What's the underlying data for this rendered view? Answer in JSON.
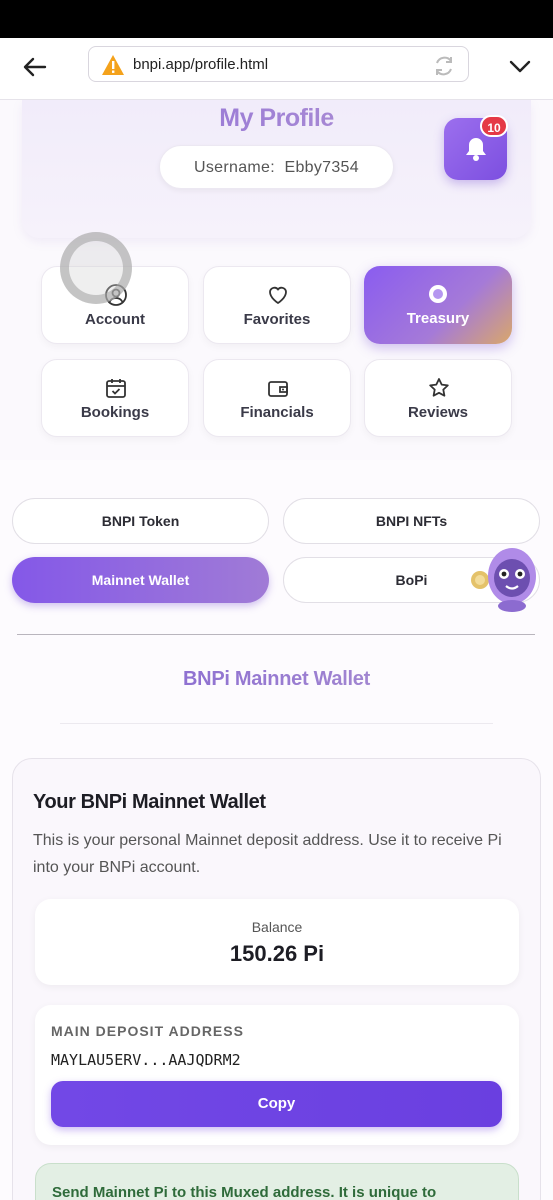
{
  "browser": {
    "url": "bnpi.app/profile.html"
  },
  "profile": {
    "title": "My Profile",
    "username_label": "Username:",
    "username": "Ebby7354",
    "notifications_count": "10"
  },
  "menu": {
    "items": [
      {
        "label": "Account",
        "icon": "user-icon"
      },
      {
        "label": "Favorites",
        "icon": "heart-icon"
      },
      {
        "label": "Treasury",
        "icon": "circle-icon",
        "active": true
      },
      {
        "label": "Bookings",
        "icon": "calendar-icon"
      },
      {
        "label": "Financials",
        "icon": "wallet-icon"
      },
      {
        "label": "Reviews",
        "icon": "star-icon"
      }
    ]
  },
  "subtabs": {
    "items": [
      {
        "label": "BNPI Token"
      },
      {
        "label": "BNPI NFTs"
      },
      {
        "label": "Mainnet Wallet",
        "active": true
      },
      {
        "label": "BoPi"
      }
    ]
  },
  "wallet": {
    "section_title": "BNPi Mainnet Wallet",
    "card_title": "Your BNPi Mainnet Wallet",
    "description": "This is your personal Mainnet deposit address. Use it to receive Pi into your BNPi account.",
    "balance_label": "Balance",
    "balance_value": "150.26 Pi",
    "address_label": "MAIN DEPOSIT ADDRESS",
    "address_value": "MAYLAU5ERV...AAJQDRM2",
    "copy_label": "Copy",
    "notice": "Send Mainnet Pi to this Muxed address. It is unique to"
  },
  "colors": {
    "accent": "#7c4fe0",
    "badge": "#e53946",
    "notice_text": "#2f6b3a"
  }
}
